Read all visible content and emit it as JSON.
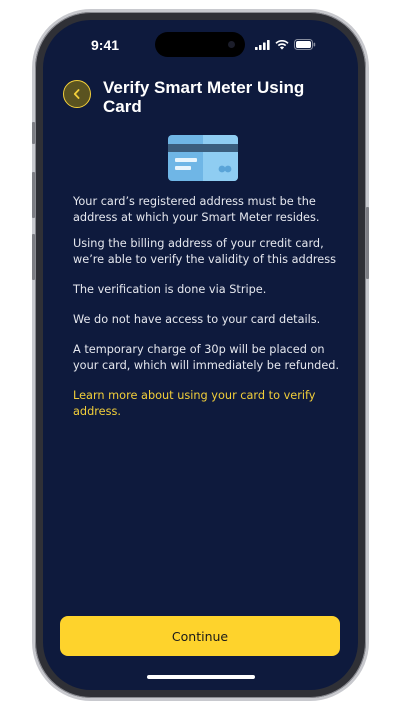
{
  "status_bar": {
    "time": "9:41",
    "icons": [
      "signal-icon",
      "wifi-icon",
      "battery-icon"
    ]
  },
  "header": {
    "back_icon": "chevron-left-icon",
    "title": "Verify Smart Meter Using Card"
  },
  "illustration": {
    "icon": "credit-card-icon"
  },
  "content": {
    "paragraphs": [
      "Your card’s registered address must be the address at which your Smart Meter resides.",
      "Using the billing address of your credit card, we’re able to verify the validity of this address",
      "The verification is done via Stripe.",
      "We do not have access to your card details.",
      "A temporary charge of 30p will be placed on your card, which will immediately be refunded."
    ],
    "learn_more_link": "Learn more about using your card to verify address."
  },
  "footer": {
    "continue_label": "Continue"
  },
  "colors": {
    "background": "#0e1a3d",
    "accent": "#fed32c",
    "link": "#f2cf3a",
    "text": "#e6e8ef"
  }
}
